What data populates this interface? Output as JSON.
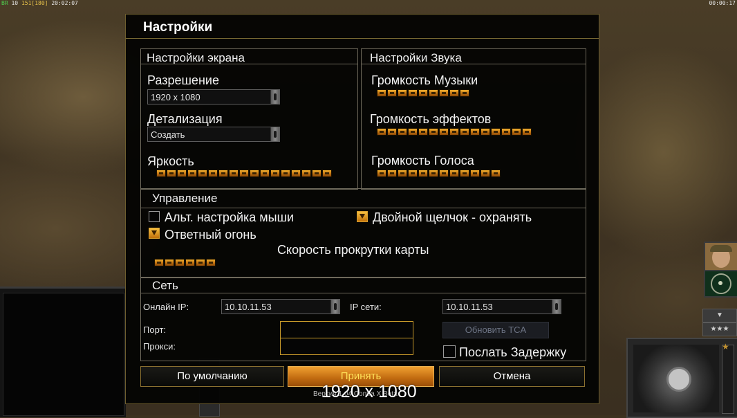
{
  "hud": {
    "tl_prefix": "ВR",
    "tl_a": "10",
    "tl_b": "151",
    "tl_c": "[180]",
    "tl_time": "20:02:07",
    "tr_time": "00:00:17"
  },
  "dialog": {
    "title": "Настройки",
    "screen": {
      "title": "Настройки экрана",
      "resolution_label": "Разрешение",
      "resolution_value": "1920 x 1080",
      "detail_label": "Детализация",
      "detail_value": "Создать",
      "brightness_label": "Яркость",
      "brightness_level": 1.0
    },
    "sound": {
      "title": "Настройки Звука",
      "music_label": "Громкость Музыки",
      "music_level": 0.6,
      "effects_label": "Громкость эффектов",
      "effects_level": 1.0,
      "voice_label": "Громкость Голоса",
      "voice_level": 0.8
    },
    "control": {
      "title": "Управление",
      "alt_mouse_label": "Альт. настройка мыши",
      "alt_mouse_checked": false,
      "double_click_label": "Двойной щелчок - охранять",
      "double_click_checked": true,
      "return_fire_label": "Ответный огонь",
      "return_fire_checked": true,
      "scroll_speed_label": "Скорость прокрутки карты",
      "scroll_speed_level": 0.4
    },
    "network": {
      "title": "Сеть",
      "online_ip_label": "Онлайн IP:",
      "online_ip_value": "10.10.11.53",
      "net_ip_label": "IP сети:",
      "net_ip_value": "10.10.11.53",
      "port_label": "Порт:",
      "port_value": "",
      "proxy_label": "Прокси:",
      "proxy_value": "",
      "update_tca_label": "Обновить TCA",
      "send_delay_label": "Послать Задержку",
      "send_delay_checked": false
    },
    "buttons": {
      "default_label": "По умолчанию",
      "accept_label": "Принять",
      "cancel_label": "Отмена"
    }
  },
  "overlay": {
    "big_text": "1920 x 1080",
    "small_text": "Версия 1.04 Contra X Beta"
  },
  "side": {
    "stars_label": "★★★"
  }
}
